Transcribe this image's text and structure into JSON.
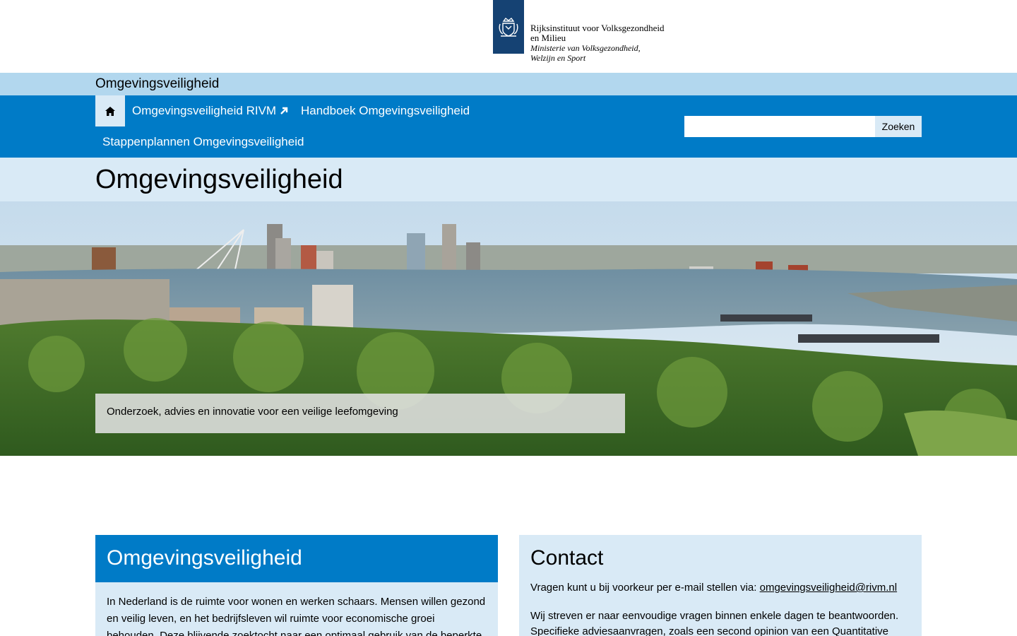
{
  "logo": {
    "line1": "Rijksinstituut voor Volksgezondheid",
    "line2": "en Milieu",
    "line3": "Ministerie van Volksgezondheid,",
    "line4": "Welzijn en Sport",
    "emblem_icon": "crown-lion-emblem-icon"
  },
  "site": {
    "title": "Omgevingsveiligheid"
  },
  "nav": {
    "home_icon": "home-icon",
    "items": [
      {
        "label": "Omgevingsveiligheid RIVM",
        "external_icon": "external-link-icon"
      },
      {
        "label": "Handboek Omgevingsveiligheid"
      },
      {
        "label": "Stappenplannen Omgevingsveiligheid"
      }
    ],
    "search": {
      "placeholder": "",
      "value": "",
      "button_label": "Zoeken"
    }
  },
  "page": {
    "title": "Omgevingsveiligheid"
  },
  "hero": {
    "caption": "Onderzoek, advies en innovatie voor een veilige leefomgeving"
  },
  "cards": {
    "left": {
      "title": "Omgevingsveiligheid",
      "body": "In Nederland is de ruimte voor wonen en werken schaars. Mensen willen gezond en veilig leven, en het bedrijfsleven wil ruimte voor economische groei behouden. Deze blijvende zoektocht naar een optimaal gebruik van de beperkte ruimte is het"
    },
    "right": {
      "title": "Contact",
      "p1_prefix": "Vragen kunt u bij voorkeur per e-mail stellen via: ",
      "p1_link": "omgevingsveiligheid@rivm.nl",
      "p2": "Wij streven er naar eenvoudige vragen binnen enkele dagen te beantwoorden. Specifieke adviesaanvragen, zoals een second opinion van een Quantitative Risk"
    }
  },
  "colors": {
    "brand_blue": "#007bc7",
    "light_blue": "#d9eaf6",
    "site_bar": "#b2d7ee",
    "logo_navy": "#154273"
  }
}
